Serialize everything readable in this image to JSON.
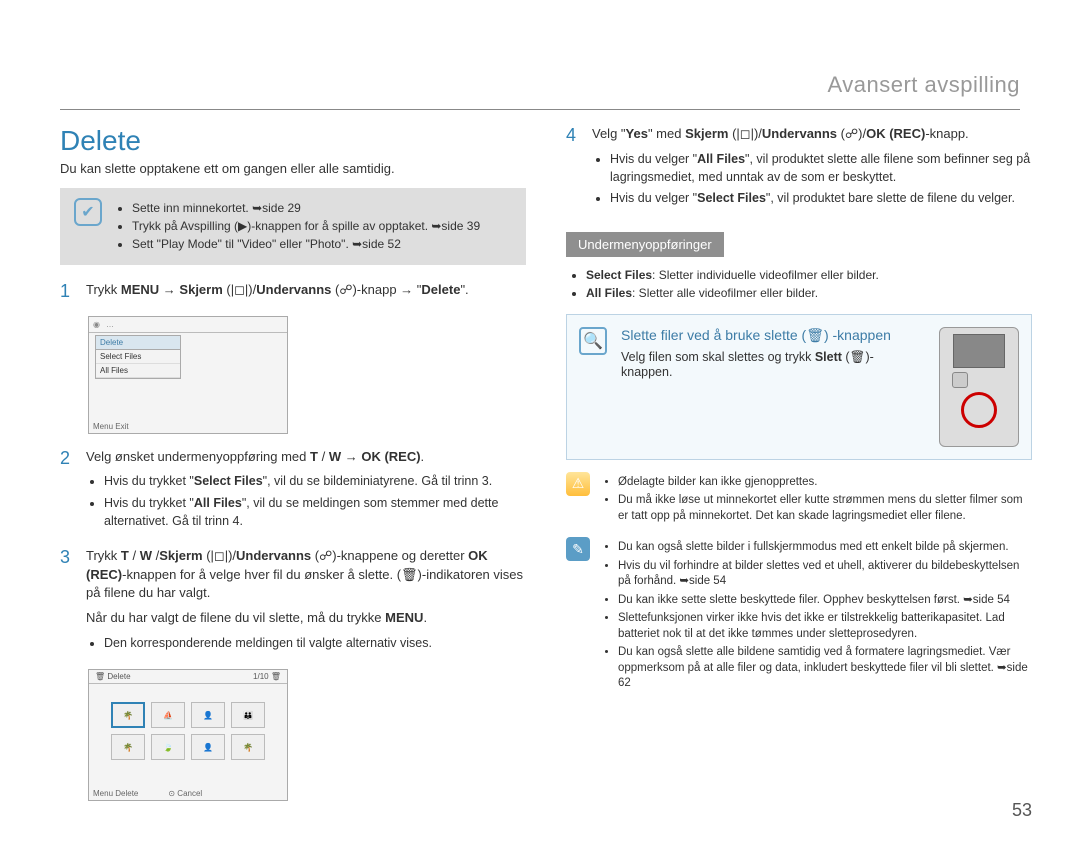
{
  "header": {
    "section_title": "Avansert avspilling"
  },
  "page_number": "53",
  "left": {
    "h1": "Delete",
    "intro": "Du kan slette opptakene ett om gangen eller alle samtidig.",
    "prereq": {
      "items": [
        "Sette inn minnekortet. ➥side 29",
        "Trykk på Avspilling (▶)-knappen for å spille av opptaket. ➥side 39",
        "Sett \"Play Mode\" til \"Video\" eller \"Photo\". ➥side 52"
      ]
    },
    "step1": {
      "num": "1",
      "text_a": "Trykk ",
      "menu": "MENU",
      "text_b": " → ",
      "skjerm": "Skjerm",
      "text_c": " (|◻|)/",
      "undervanns": "Undervanns",
      "text_d": " (☍)-knapp → \"",
      "delete": "Delete",
      "text_e": "\"."
    },
    "ss1": {
      "menu_hdr": "Delete",
      "item1": "Select Files",
      "item2": "All Files",
      "footer": "Menu Exit"
    },
    "step2": {
      "num": "2",
      "text": "Velg ønsket undermenyoppføring med T / W → OK (REC).",
      "b1": "Hvis du trykket \"Select Files\", vil du se bildeminiatyrene. Gå til trinn 3.",
      "b2": "Hvis du trykket \"All Files\", vil du se meldingen som stemmer med dette alternativet. Gå til trinn 4."
    },
    "step3": {
      "num": "3",
      "text": "Trykk T / W /Skjerm (|◻|)/Undervanns (☍)-knappene og deretter OK (REC)-knappen for å velge hver fil du ønsker å slette. (🗑)-indikatoren vises på filene du har valgt.",
      "p2": "Når du har valgt de filene du vil slette, må du trykke MENU.",
      "b1": "Den korresponderende meldingen til valgte alternativ vises."
    },
    "ss2": {
      "title": "Delete",
      "counter": "1/10 🗑",
      "footer_left": "Menu Delete",
      "footer_right": "⊙ Cancel"
    }
  },
  "right": {
    "step4": {
      "num": "4",
      "text": "Velg \"Yes\" med Skjerm (|◻|)/Undervanns (☍)/OK (REC)-knapp.",
      "b1": "Hvis du velger \"All Files\", vil produktet slette alle filene som befinner seg på lagringsmediet, med unntak av de som er beskyttet.",
      "b2": "Hvis du velger \"Select Files\", vil produktet bare slette de filene du velger."
    },
    "submenu": {
      "heading": "Undermenyoppføringer",
      "items": [
        "Select Files: Sletter individuelle videofilmer eller bilder.",
        "All Files: Sletter alle videofilmer eller bilder."
      ]
    },
    "bluebox": {
      "title": "Slette filer ved å bruke slette (🗑) -knappen",
      "text": "Velg filen som skal slettes og trykk Slett (🗑)-knappen."
    },
    "warn": {
      "items": [
        "Ødelagte bilder kan ikke gjenopprettes.",
        "Du må ikke løse ut minnekortet eller kutte strømmen mens du sletter filmer som er tatt opp på minnekortet. Det kan skade lagringsmediet eller filene."
      ]
    },
    "info": {
      "items": [
        "Du kan også slette bilder i fullskjermmodus med ett enkelt bilde på skjermen.",
        "Hvis du vil forhindre at bilder slettes ved et uhell, aktiverer du bildebeskyttelsen på forhånd. ➥side 54",
        "Du kan ikke sette slette beskyttede filer. Opphev beskyttelsen først. ➥side 54",
        "Slettefunksjonen virker ikke hvis det ikke er tilstrekkelig batterikapasitet. Lad batteriet nok til at det ikke tømmes under sletteprosedyren.",
        "Du kan også slette alle bildene samtidig ved å formatere lagringsmediet. Vær oppmerksom på at alle filer og data, inkludert beskyttede filer vil bli slettet. ➥side 62"
      ]
    }
  }
}
